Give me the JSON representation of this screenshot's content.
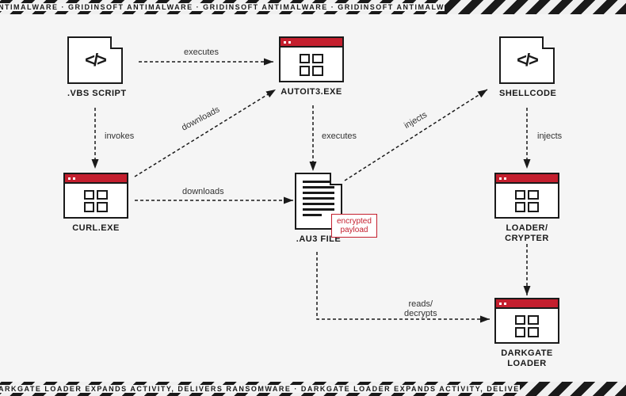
{
  "watermark_top": "ANTIMALWARE  ·  GRIDINSOFT ANTIMALWARE  ·  GRIDINSOFT ANTIMALWARE  ·  GRIDINSOFT ANTIMALW",
  "watermark_bottom": "DARKGATE LOADER EXPANDS ACTIVITY, DELIVERS RANSOMWARE  ·  DARKGATE LOADER EXPANDS ACTIVITY, DELIVE",
  "nodes": {
    "vbs": {
      "label": ".VBS SCRIPT",
      "glyph": "</>"
    },
    "curl": {
      "label": "CURL.EXE"
    },
    "autoit": {
      "label": "AUTOIT3.EXE"
    },
    "au3": {
      "label": ".AU3 FILE"
    },
    "payload_tag": "encrypted\npayload",
    "shellcode": {
      "label": "SHELLCODE",
      "glyph": "</>"
    },
    "loader": {
      "label": "LOADER/\nCRYPTER"
    },
    "darkgate": {
      "label": "DARKGATE\nLOADER"
    }
  },
  "edges": {
    "vbs_autoit": "executes",
    "vbs_curl": "invokes",
    "curl_autoit": "downloads",
    "curl_au3": "downloads",
    "autoit_au3": "executes",
    "au3_shellcode": "injects",
    "shellcode_loader": "injects",
    "au3_darkgate": "reads/\ndecrypts"
  }
}
